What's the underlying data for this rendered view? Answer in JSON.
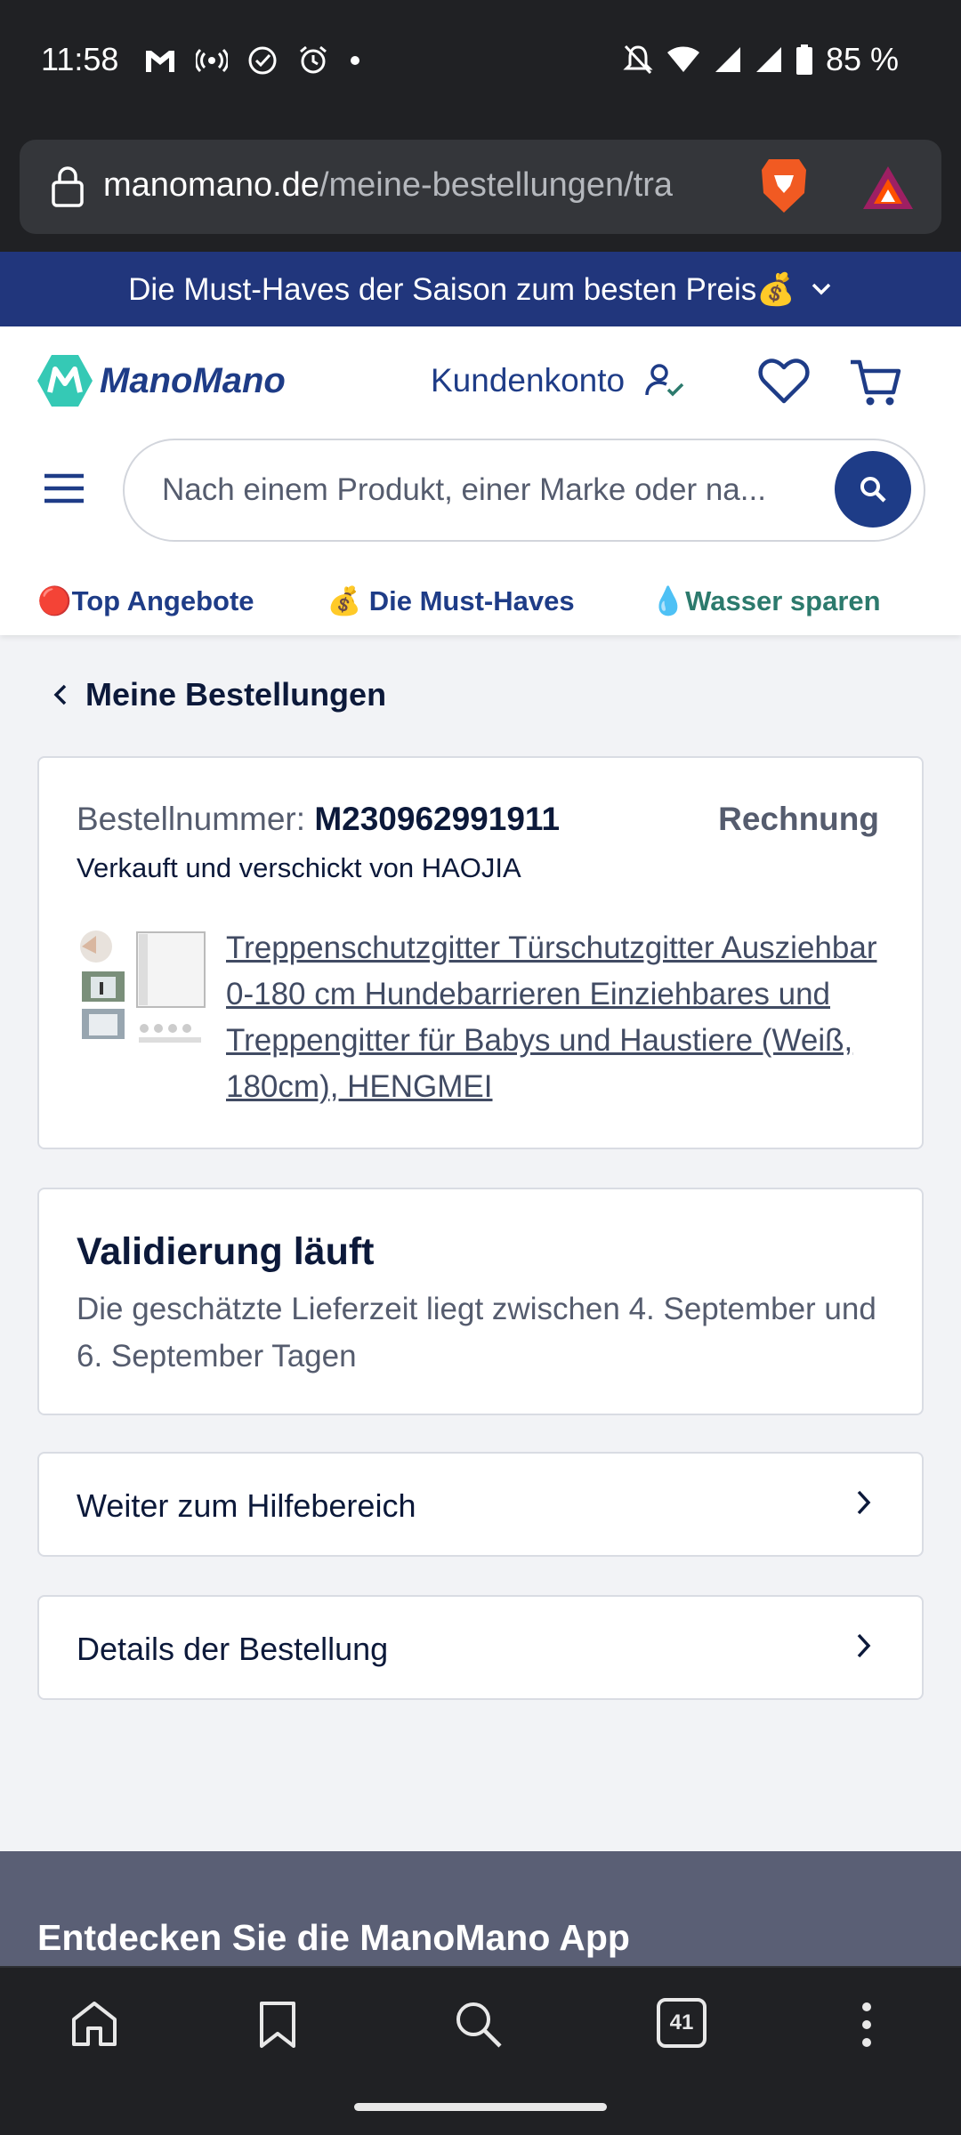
{
  "status_bar": {
    "time": "11:58",
    "battery": "85 %",
    "icons": [
      "gmail-icon",
      "hotspot-icon",
      "check-circle-icon",
      "alarm-icon",
      "dot-icon",
      "mute-icon",
      "wifi-icon",
      "signal-icon",
      "signal-icon",
      "battery-icon"
    ]
  },
  "browser": {
    "url_domain": "manomano.de",
    "url_path": "/meine-bestellungen/tra",
    "tab_count": "41"
  },
  "banner": {
    "text": "Die Must-Haves der Saison zum besten Preis💰"
  },
  "header": {
    "logo_text": "ManoMano",
    "account_label": "Kundenkonto",
    "search_placeholder": "Nach einem Produkt, einer Marke oder na..."
  },
  "tags": [
    {
      "label": "🔴Top Angebote"
    },
    {
      "label": "💰 Die Must-Haves"
    },
    {
      "label": "💧Wasser sparen"
    }
  ],
  "page": {
    "back_label": "Meine Bestellungen",
    "order_number_label": "Bestellnummer:",
    "order_number": "M230962991911",
    "invoice_label": "Rechnung",
    "seller": "Verkauft und verschickt von HAOJIA",
    "product_title": "Treppenschutzgitter Türschutzgitter Ausziehbar 0-180 cm Hundebarrieren Einziehbares und Treppengitter für Babys und Haustiere (Weiß, 180cm), HENGMEI",
    "status_title": "Validierung läuft",
    "status_text": "Die geschätzte Lieferzeit liegt zwischen 4. September und 6. September Tagen",
    "help_label": "Weiter zum Hilfebereich",
    "details_label": "Details der Bestellung",
    "app_title": "Entdecken Sie die ManoMano App"
  },
  "colors": {
    "brand_blue": "#1e3c87",
    "banner_blue": "#21367c",
    "teal": "#2c7a6d",
    "page_bg": "#f2f3f6"
  }
}
